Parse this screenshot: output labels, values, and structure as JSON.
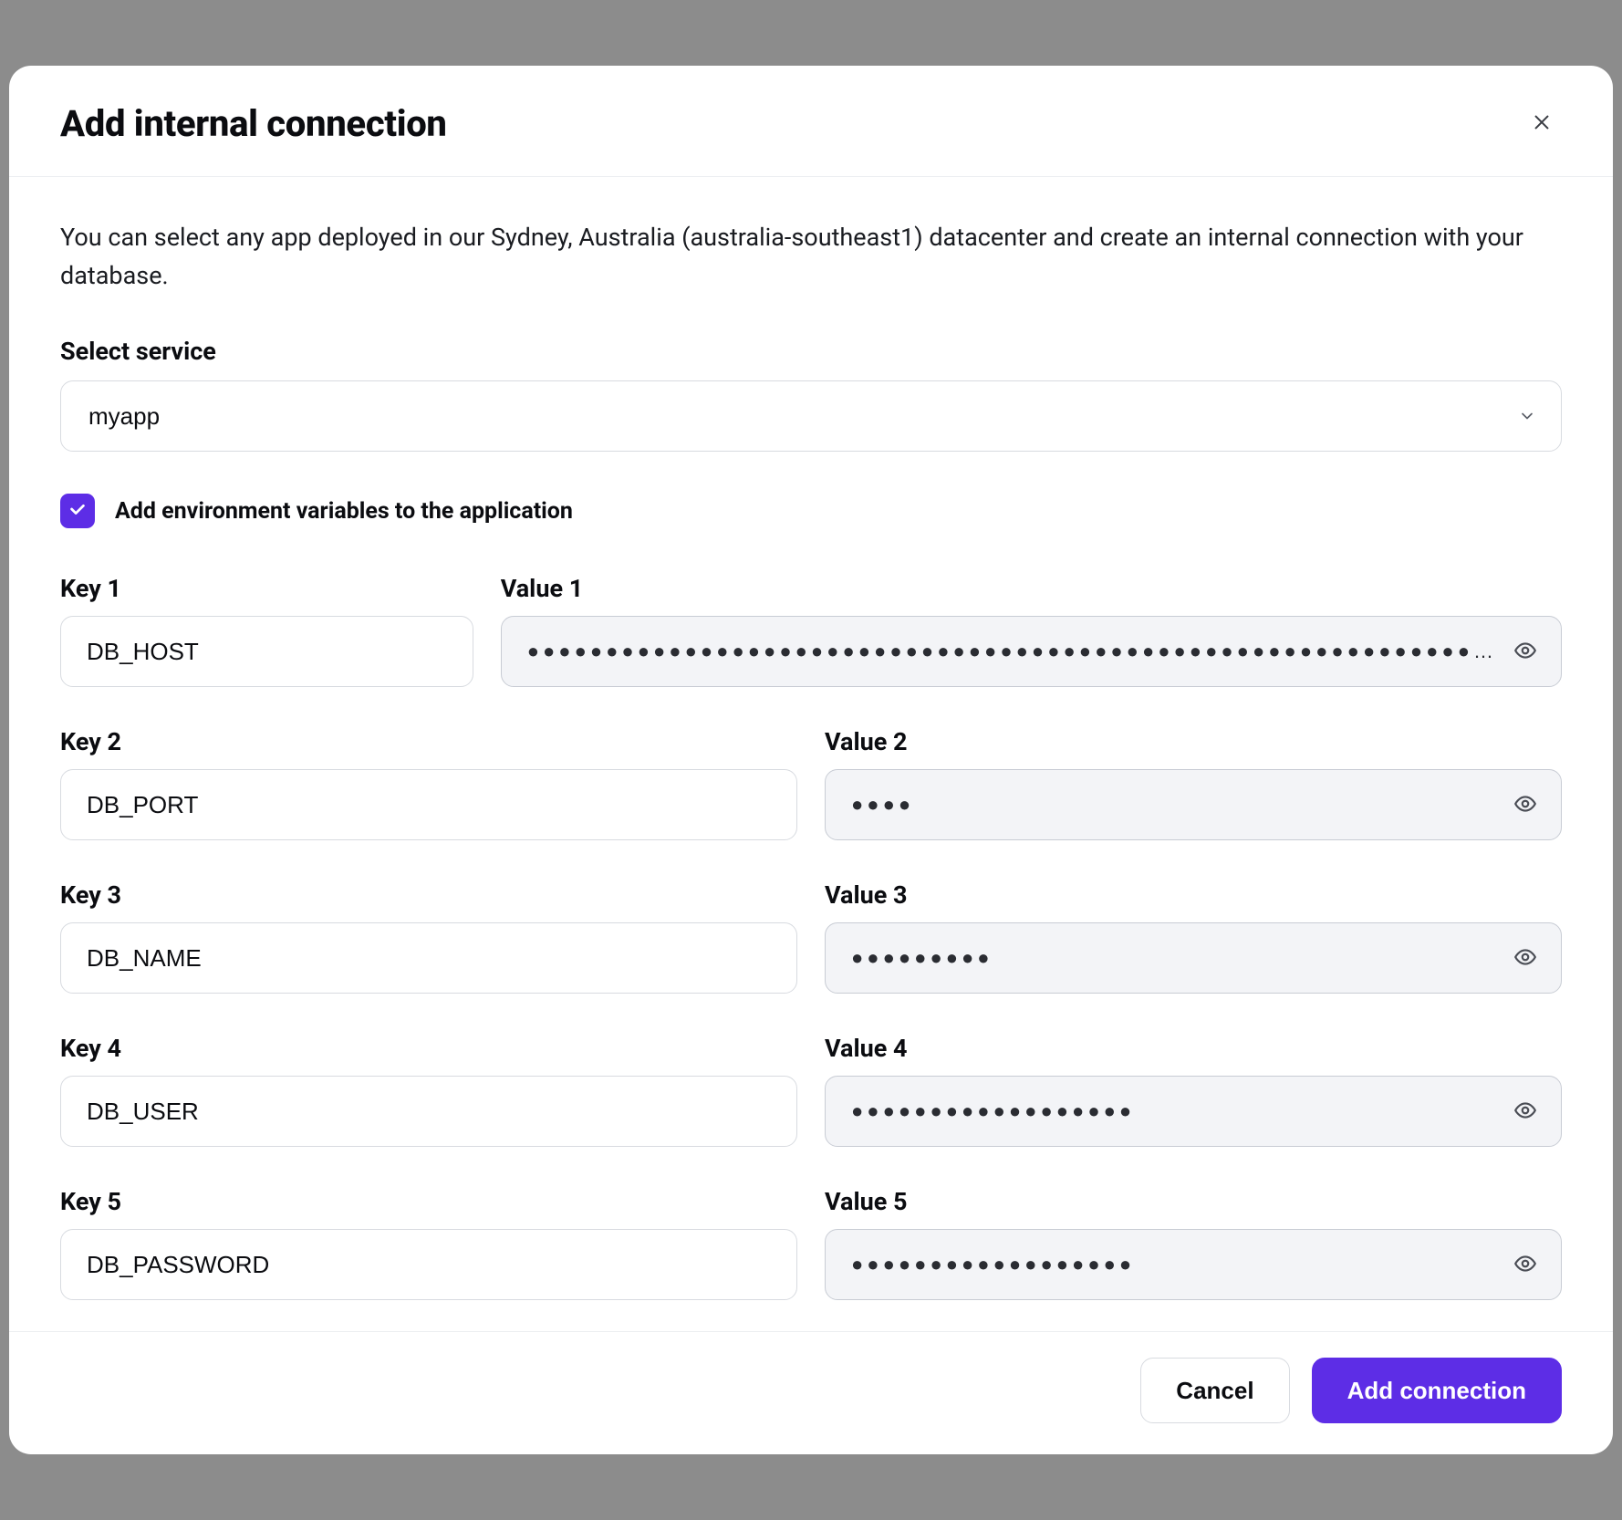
{
  "modal": {
    "title": "Add internal connection",
    "description": "You can select any app deployed in our Sydney, Australia (australia-southeast1) datacenter and create an internal connection with your database."
  },
  "service": {
    "label": "Select service",
    "selected": "myapp"
  },
  "checkbox": {
    "checked": true,
    "label": "Add environment variables to the application"
  },
  "pairs": [
    {
      "key_label": "Key 1",
      "value_label": "Value 1",
      "key": "DB_HOST",
      "masked_value": "●●●●●●●●●●●●●●●●●●●●●●●●●●●●●●●●●●●●●●●●●●●●●●●●●●●●●●●●●●●●…"
    },
    {
      "key_label": "Key 2",
      "value_label": "Value 2",
      "key": "DB_PORT",
      "masked_value": "●●●●"
    },
    {
      "key_label": "Key 3",
      "value_label": "Value 3",
      "key": "DB_NAME",
      "masked_value": "●●●●●●●●●"
    },
    {
      "key_label": "Key 4",
      "value_label": "Value 4",
      "key": "DB_USER",
      "masked_value": "●●●●●●●●●●●●●●●●●●"
    },
    {
      "key_label": "Key 5",
      "value_label": "Value 5",
      "key": "DB_PASSWORD",
      "masked_value": "●●●●●●●●●●●●●●●●●●"
    }
  ],
  "footer": {
    "cancel": "Cancel",
    "submit": "Add connection"
  },
  "colors": {
    "accent": "#5d2de6"
  }
}
